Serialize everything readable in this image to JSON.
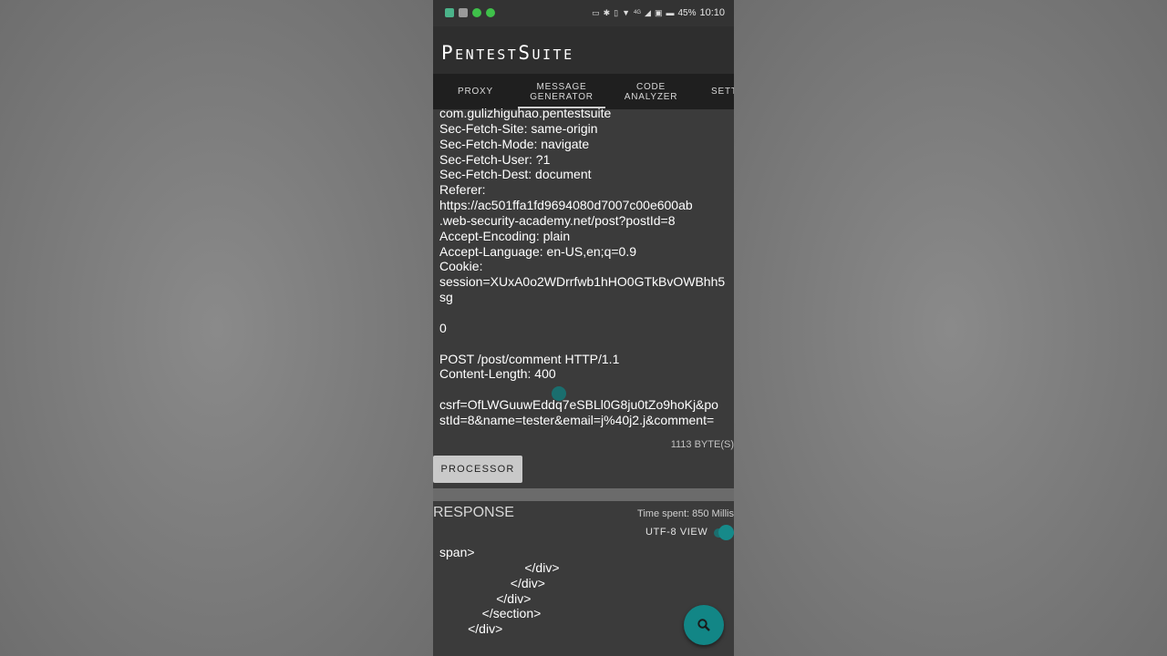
{
  "statusbar": {
    "battery": "45%",
    "time": "10:10",
    "network": "4G",
    "icons": [
      "cast-icon",
      "bluetooth-icon",
      "vibrate-icon",
      "wifi-icon",
      "signal-icon",
      "hd-icon",
      "battery-icon"
    ],
    "notification_icons": [
      "app-icon",
      "app-icon",
      "app-icon",
      "app-icon"
    ]
  },
  "app": {
    "title": "PentestSuite"
  },
  "tabs": [
    {
      "label": "PROXY"
    },
    {
      "label": "MESSAGE\nGENERATOR"
    },
    {
      "label": "CODE\nANALYZER"
    },
    {
      "label": "SETTINGS"
    }
  ],
  "request": {
    "text": "com.gulizhiguhao.pentestsuite\nSec-Fetch-Site: same-origin\nSec-Fetch-Mode: navigate\nSec-Fetch-User: ?1\nSec-Fetch-Dest: document\nReferer:\nhttps://ac501ffa1fd9694080d7007c00e600ab\n.web-security-academy.net/post?postId=8\nAccept-Encoding: plain\nAccept-Language: en-US,en;q=0.9\nCookie:\nsession=XUxA0o2WDrrfwb1hHO0GTkBvOWBhh5\nsg\n\n0\n\nPOST /post/comment HTTP/1.1\nContent-Length: 400\n\ncsrf=OfLWGuuwEddq7eSBLl0G8ju0tZo9hoKj&po\nstId=8&name=tester&email=j%40j2.j&comment=",
    "size": "1113 BYTE(S)"
  },
  "processor_button": "PROCESSOR",
  "response": {
    "title": "RESPONSE",
    "time_spent": "Time spent: 850 Millis",
    "utf8_label": "UTF-8 VIEW",
    "utf8_enabled": true,
    "body": "span>\n                        </div>\n                    </div>\n                </div>\n            </section>\n        </div>"
  },
  "fab": {
    "icon": "search-icon"
  },
  "colors": {
    "accent": "#128686",
    "background": "#3b3b3b",
    "appbar": "#2e2e2e",
    "tabbar": "#1f1f1f"
  }
}
